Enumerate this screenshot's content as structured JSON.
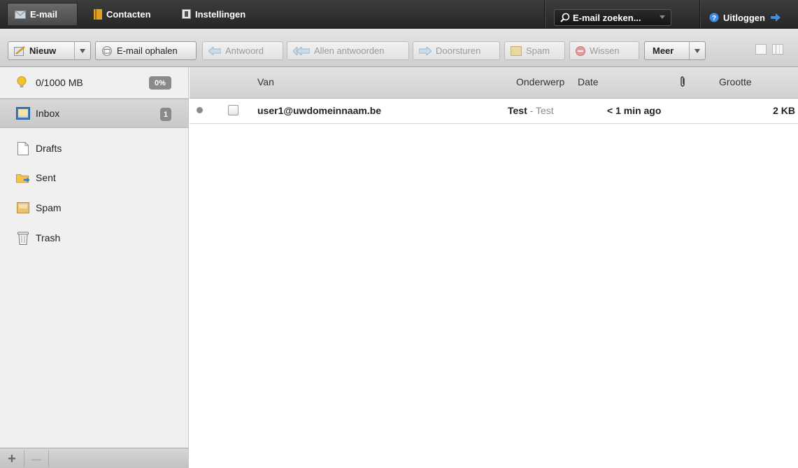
{
  "topbar": {
    "tabs": [
      {
        "label": "E-mail",
        "icon": "envelope-icon",
        "active": true
      },
      {
        "label": "Contacten",
        "icon": "address-book-icon",
        "active": false
      },
      {
        "label": "Instellingen",
        "icon": "settings-icon",
        "active": false
      }
    ],
    "search_label": "E-mail zoeken...",
    "logout_label": "Uitloggen"
  },
  "toolbar": {
    "new_label": "Nieuw",
    "fetch_label": "E-mail ophalen",
    "reply_label": "Antwoord",
    "reply_all_label": "Allen antwoorden",
    "forward_label": "Doorsturen",
    "spam_label": "Spam",
    "delete_label": "Wissen",
    "more_label": "Meer"
  },
  "sidebar": {
    "quota_label": "0/1000 MB",
    "quota_percent_label": "0%",
    "quota_percent": 0,
    "folders": [
      {
        "label": "Inbox",
        "icon": "inbox-icon",
        "count": "1",
        "active": true
      },
      {
        "label": "Drafts",
        "icon": "drafts-icon"
      },
      {
        "label": "Sent",
        "icon": "sent-icon"
      },
      {
        "label": "Spam",
        "icon": "spam-icon"
      },
      {
        "label": "Trash",
        "icon": "trash-icon"
      }
    ],
    "add_label": "+",
    "remove_label": "—"
  },
  "list": {
    "columns": {
      "from": "Van",
      "subject": "Onderwerp",
      "date": "Date",
      "size": "Grootte"
    },
    "rows": [
      {
        "from": "user1@uwdomeinnaam.be",
        "subject": "Test",
        "separator": " - ",
        "preview": "Test",
        "date": "< 1 min ago",
        "size": "2 KB"
      }
    ]
  },
  "colors": {
    "accent": "#3a8ee6",
    "topbar": "#2f2f2f"
  }
}
